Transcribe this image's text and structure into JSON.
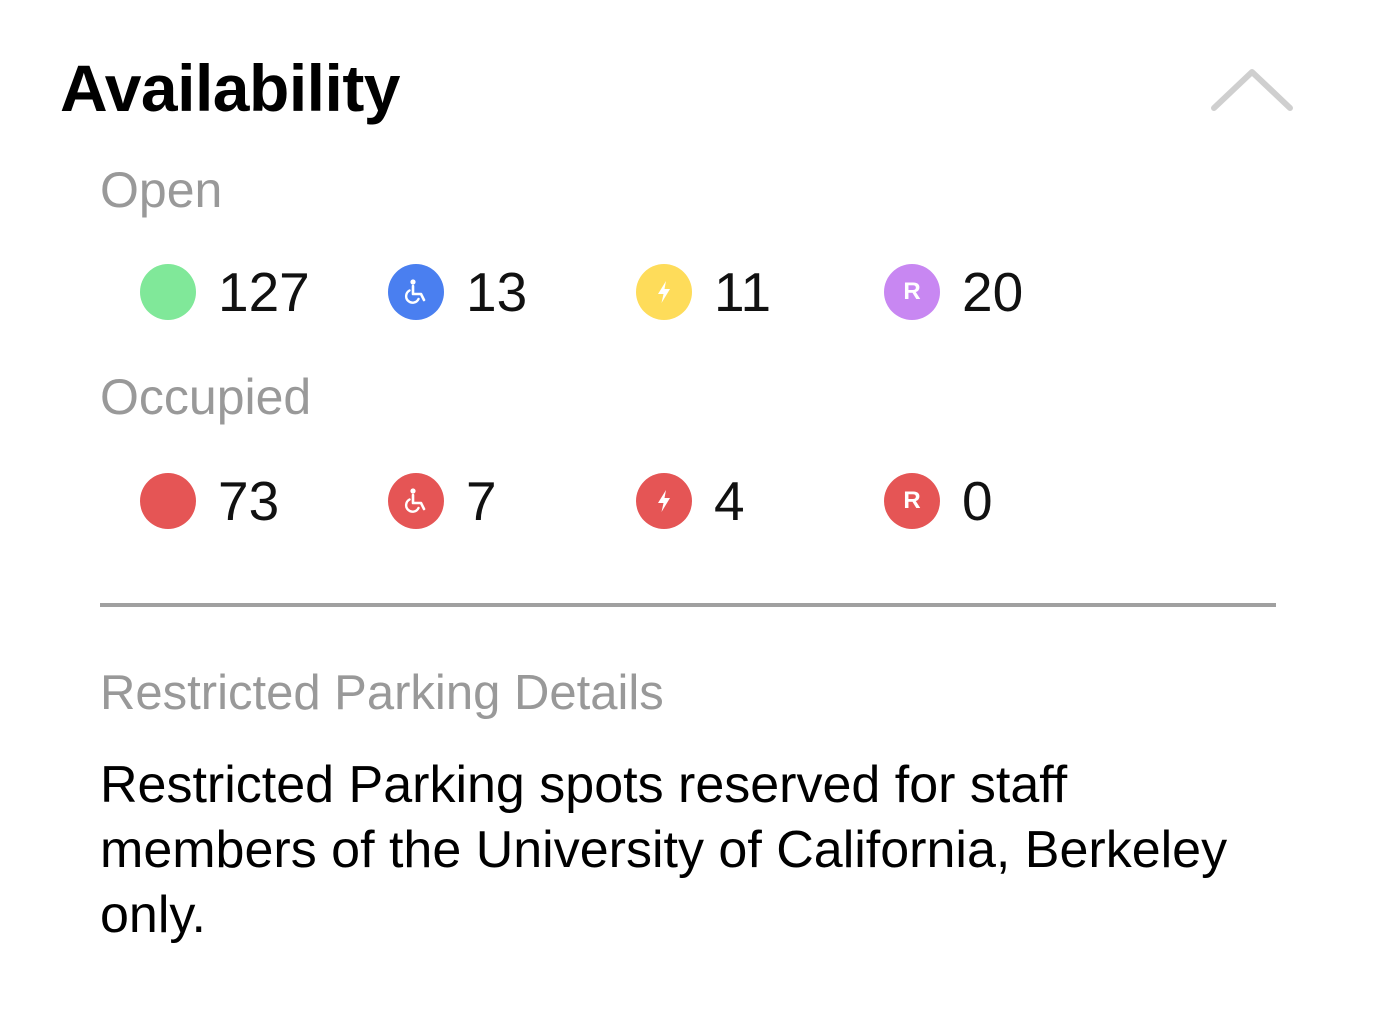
{
  "header": {
    "title": "Availability",
    "collapse_icon": "chevron-up-icon"
  },
  "colors": {
    "open_general": "#80e899",
    "open_accessible": "#4a7ff0",
    "open_ev": "#fedc5a",
    "open_restricted": "#c887f2",
    "occupied": "#e55555",
    "label_gray": "#999999",
    "divider": "#a0a0a0"
  },
  "open": {
    "label": "Open",
    "stats": [
      {
        "type": "general",
        "icon": "green-dot-icon",
        "value": "127"
      },
      {
        "type": "accessible",
        "icon": "wheelchair-icon",
        "value": "13"
      },
      {
        "type": "ev",
        "icon": "lightning-icon",
        "value": "11"
      },
      {
        "type": "restricted",
        "icon": "restricted-r-icon",
        "icon_letter": "R",
        "value": "20"
      }
    ]
  },
  "occupied": {
    "label": "Occupied",
    "stats": [
      {
        "type": "general",
        "icon": "red-dot-icon",
        "value": "73"
      },
      {
        "type": "accessible",
        "icon": "wheelchair-icon",
        "value": "7"
      },
      {
        "type": "ev",
        "icon": "lightning-icon",
        "value": "4"
      },
      {
        "type": "restricted",
        "icon": "restricted-r-icon",
        "icon_letter": "R",
        "value": "0"
      }
    ]
  },
  "restricted_details": {
    "label": "Restricted Parking Details",
    "text": "Restricted Parking spots reserved for staff members of the University of California, Berkeley only."
  }
}
